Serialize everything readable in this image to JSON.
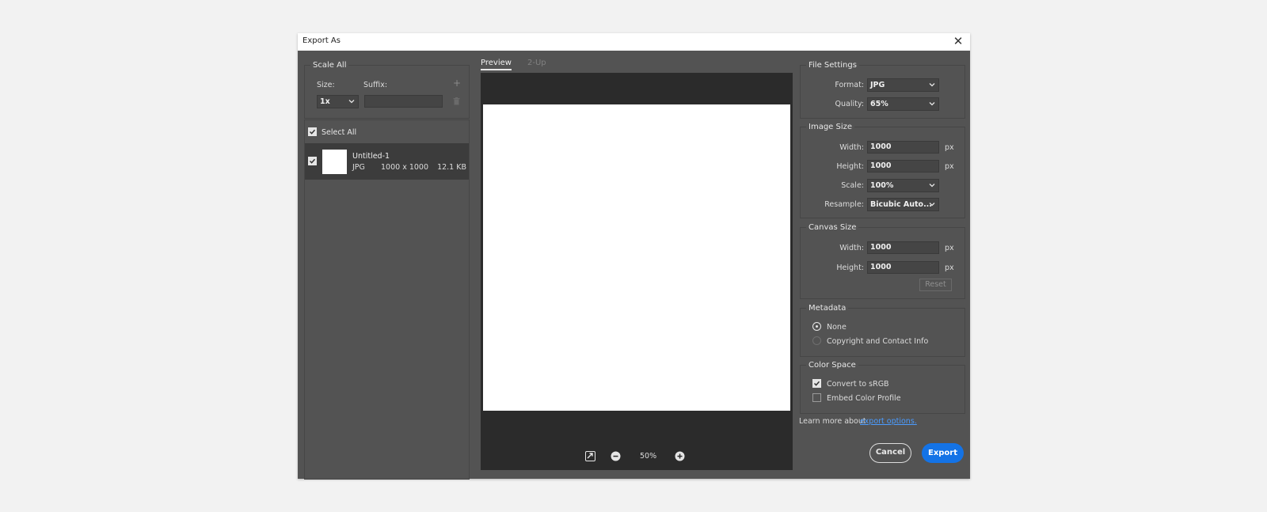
{
  "window": {
    "title": "Export As",
    "close_icon": "close-icon"
  },
  "left": {
    "scale_all_title": "Scale All",
    "size_label": "Size:",
    "suffix_label": "Suffix:",
    "size_value": "1x",
    "suffix_value": "",
    "select_all_label": "Select All",
    "select_all_checked": true,
    "asset": {
      "name": "Untitled-1",
      "format": "JPG",
      "dimensions": "1000 x 1000",
      "filesize": "12.1 KB",
      "checked": true
    }
  },
  "preview": {
    "tabs": [
      {
        "label": "Preview",
        "active": true
      },
      {
        "label": "2-Up",
        "active": false
      }
    ],
    "zoom": "50%"
  },
  "file_settings": {
    "title": "File Settings",
    "format_label": "Format:",
    "format_value": "JPG",
    "quality_label": "Quality:",
    "quality_value": "65%"
  },
  "image_size": {
    "title": "Image Size",
    "width_label": "Width:",
    "width_value": "1000",
    "width_unit": "px",
    "height_label": "Height:",
    "height_value": "1000",
    "height_unit": "px",
    "scale_label": "Scale:",
    "scale_value": "100%",
    "resample_label": "Resample:",
    "resample_value": "Bicubic Auto..."
  },
  "canvas_size": {
    "title": "Canvas Size",
    "width_label": "Width:",
    "width_value": "1000",
    "width_unit": "px",
    "height_label": "Height:",
    "height_value": "1000",
    "height_unit": "px",
    "reset_label": "Reset"
  },
  "metadata": {
    "title": "Metadata",
    "options": [
      {
        "label": "None",
        "selected": true
      },
      {
        "label": "Copyright and Contact Info",
        "selected": false
      }
    ]
  },
  "color_space": {
    "title": "Color Space",
    "convert_label": "Convert to sRGB",
    "convert_checked": true,
    "embed_label": "Embed Color Profile",
    "embed_checked": false
  },
  "footer": {
    "learn_text": "Learn more about",
    "learn_link": "export options.",
    "cancel_label": "Cancel",
    "export_label": "Export"
  },
  "colors": {
    "accent": "#1473e6",
    "dialog_bg": "#535353",
    "preview_bg": "#2b2b2b",
    "link": "#4b9cff"
  }
}
